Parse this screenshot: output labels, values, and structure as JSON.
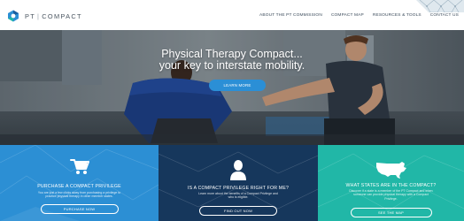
{
  "header": {
    "logo_text": "PT",
    "logo_text2": "COMPACT",
    "nav": [
      {
        "label": "About the PT Commission"
      },
      {
        "label": "Compact Map"
      },
      {
        "label": "Resources & Tools"
      },
      {
        "label": "Contact Us"
      }
    ]
  },
  "hero": {
    "title_line1": "Physical Therapy Compact...",
    "title_line2": "your key to interstate mobility.",
    "cta_label": "Learn More"
  },
  "panels": [
    {
      "icon": "shopping-cart-icon",
      "heading": "Purchase a Compact Privilege",
      "text_line1": "You are just a few clicks away from purchasing a privilege to",
      "text_line2": "practice physical therapy in other member states.",
      "button": "Purchase Now",
      "color": "#2c8fd4"
    },
    {
      "icon": "person-icon",
      "heading": "Is a Compact Privilege Right For Me?",
      "text_line1": "Learn more about the benefits of a Compact Privilege and",
      "text_line2": "who is eligible.",
      "button": "Find Out Now",
      "color": "#16375c"
    },
    {
      "icon": "us-map-icon",
      "heading": "What States are in the Compact?",
      "text_line1": "Discover if a state is a member of the PT Compact and when",
      "text_line2": "someone can provide physical therapy with a Compact",
      "text_line3": "Privilege.",
      "button": "See the Map",
      "color": "#21b7a7"
    }
  ]
}
